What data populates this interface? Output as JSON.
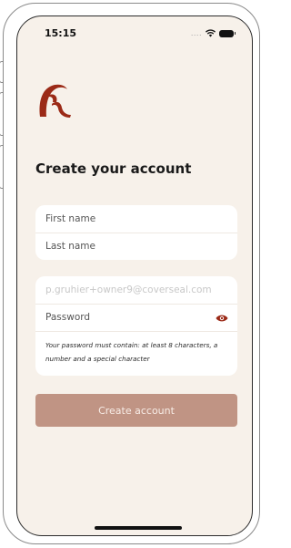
{
  "status_bar": {
    "time": "15:15",
    "signal": "....",
    "icons": [
      "wifi-icon",
      "battery-icon"
    ]
  },
  "brand": {
    "logo": "brand-logo",
    "accent_color": "#9b2a17"
  },
  "form": {
    "title": "Create your account",
    "first_name_placeholder": "First name",
    "last_name_placeholder": "Last name",
    "email_value": "p.gruhier+owner9@coverseal.com",
    "password_placeholder": "Password",
    "password_toggle_icon": "eye-icon",
    "password_hint": "Your password must contain: at least 8 characters, a number and a special character",
    "submit_label": "Create account",
    "submit_color": "#c09484"
  }
}
